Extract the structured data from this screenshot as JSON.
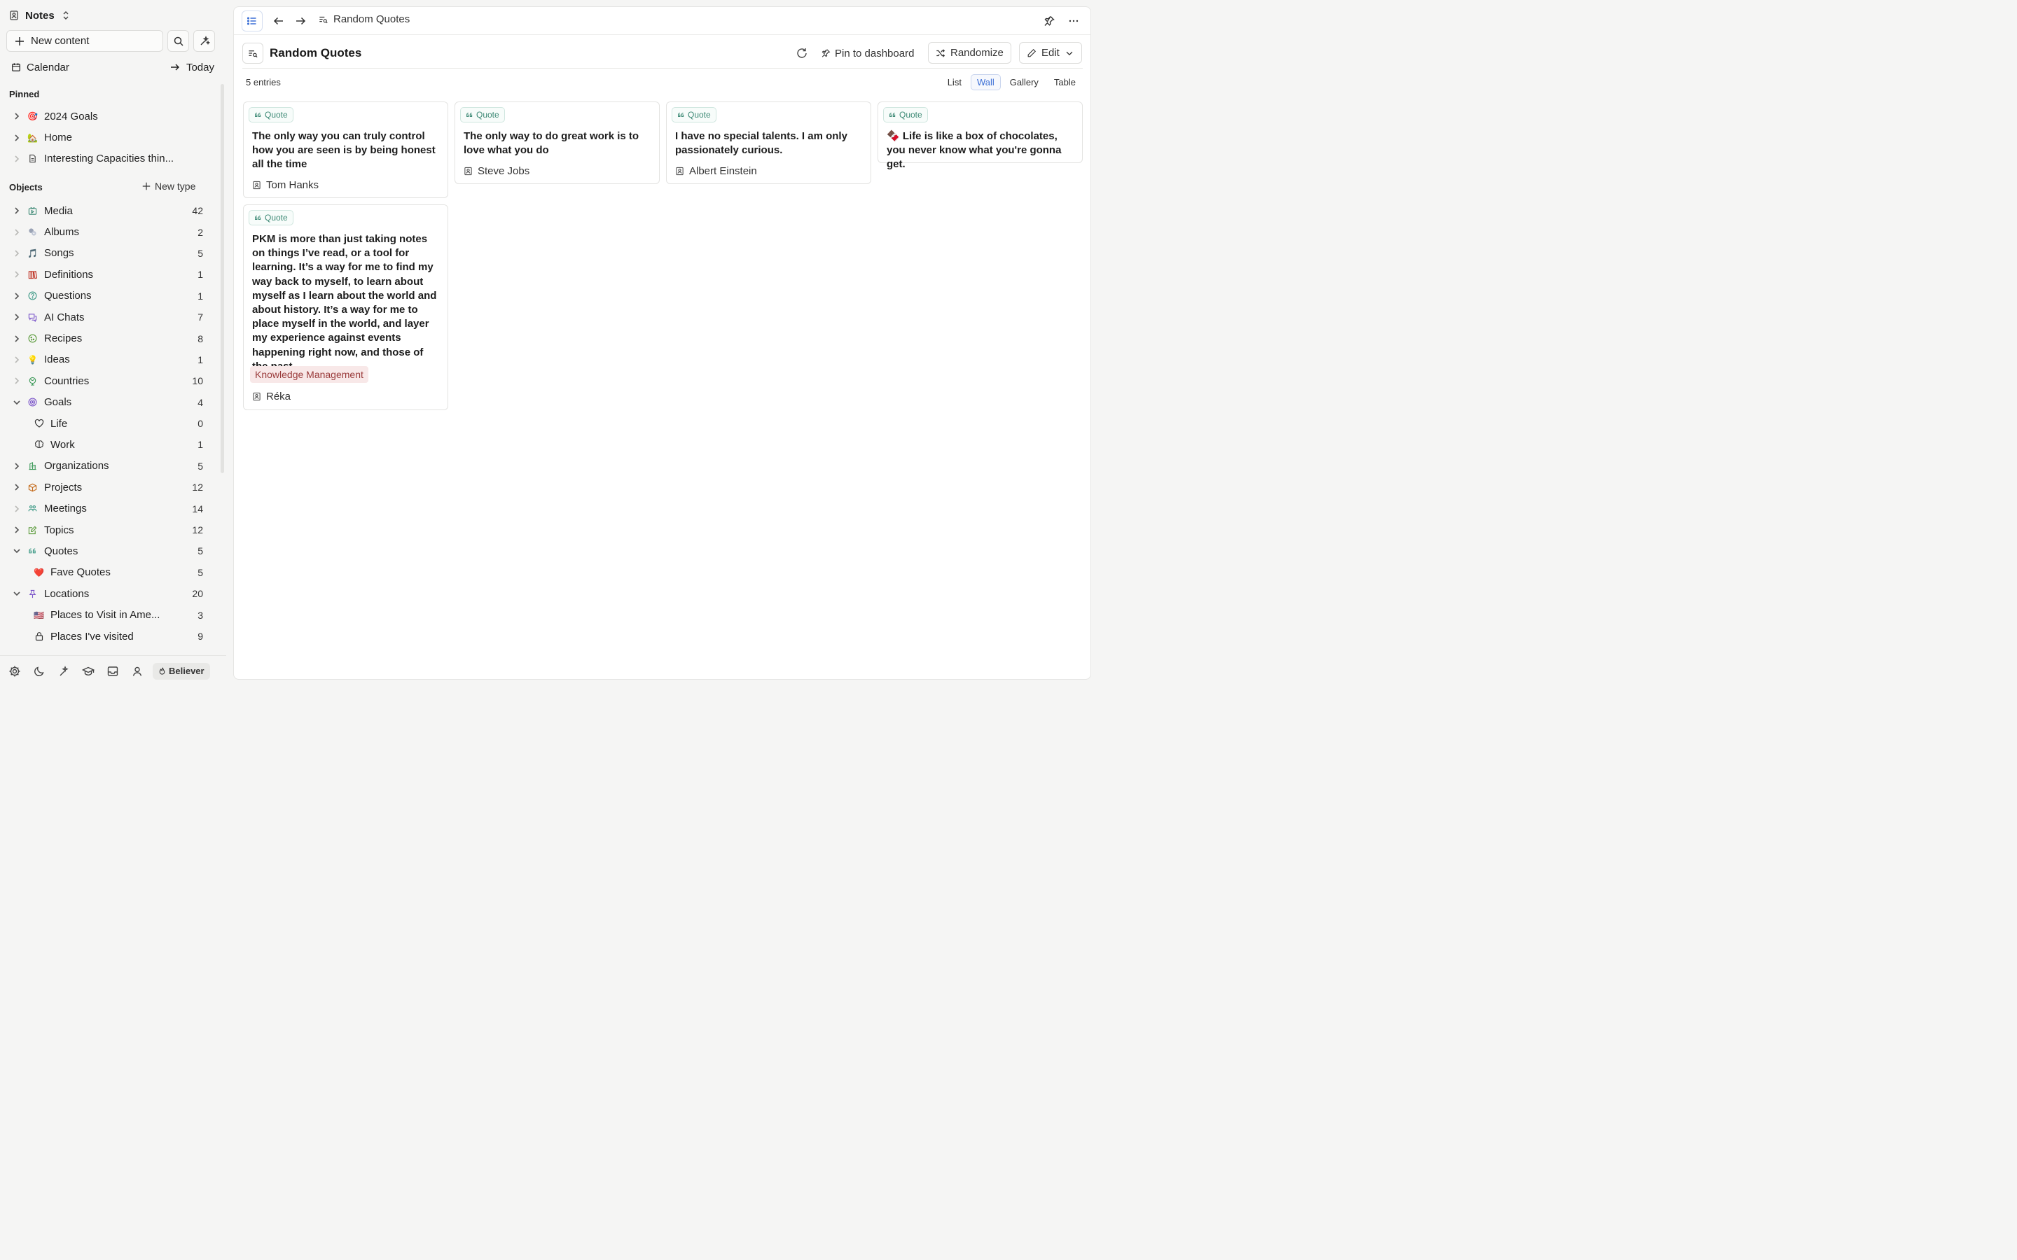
{
  "sidebar": {
    "space_title": "Notes",
    "new_content_label": "New content",
    "calendar_label": "Calendar",
    "today_label": "Today",
    "pinned_header": "Pinned",
    "pinned": [
      {
        "label": "2024 Goals",
        "icon": "🎯"
      },
      {
        "label": "Home",
        "icon": "🏡"
      },
      {
        "label": "Interesting Capacities thin...",
        "icon": "document-icon"
      }
    ],
    "objects_header": "Objects",
    "new_type_label": "New type",
    "objects": [
      {
        "label": "Media",
        "count": "42",
        "icon": "media-icon",
        "color": "#3e8a76"
      },
      {
        "label": "Albums",
        "count": "2",
        "icon": "albums-icon"
      },
      {
        "label": "Songs",
        "count": "5",
        "icon": "🎵"
      },
      {
        "label": "Definitions",
        "count": "1",
        "icon": "books-icon",
        "color": "#c0392b"
      },
      {
        "label": "Questions",
        "count": "1",
        "icon": "question-icon",
        "color": "#3e9a86"
      },
      {
        "label": "AI Chats",
        "count": "7",
        "icon": "chat-icon",
        "color": "#7b55c9"
      },
      {
        "label": "Recipes",
        "count": "8",
        "icon": "cookie-icon",
        "color": "#5a9a3a"
      },
      {
        "label": "Ideas",
        "count": "1",
        "icon": "💡"
      },
      {
        "label": "Countries",
        "count": "10",
        "icon": "globe-icon",
        "color": "#3e9a5a"
      },
      {
        "label": "Goals",
        "count": "4",
        "icon": "target-icon",
        "color": "#7b55c9"
      },
      {
        "label": "Life",
        "count": "0",
        "icon": "heart-icon"
      },
      {
        "label": "Work",
        "count": "1",
        "icon": "brain-icon"
      },
      {
        "label": "Organizations",
        "count": "5",
        "icon": "building-icon",
        "color": "#3e9a5a"
      },
      {
        "label": "Projects",
        "count": "12",
        "icon": "package-icon",
        "color": "#c46a1a"
      },
      {
        "label": "Meetings",
        "count": "14",
        "icon": "people-icon",
        "color": "#3e9a86"
      },
      {
        "label": "Topics",
        "count": "12",
        "icon": "pencil-square-icon",
        "color": "#5a9a3a"
      },
      {
        "label": "Quotes",
        "count": "5",
        "icon": "quote-icon",
        "color": "#3e9a86"
      },
      {
        "label": "Fave Quotes",
        "count": "5",
        "icon": "❤️"
      },
      {
        "label": "Locations",
        "count": "20",
        "icon": "pin-icon",
        "color": "#7b55c9"
      },
      {
        "label": "Places to Visit in Ame...",
        "count": "3",
        "icon": "🇺🇸"
      },
      {
        "label": "Places I've visited",
        "count": "9",
        "icon": "lock-icon"
      }
    ],
    "footer_badge": "Believer"
  },
  "topbar": {
    "breadcrumb_label": "Random Quotes"
  },
  "page": {
    "title": "Random Quotes",
    "pin_label": "Pin to dashboard",
    "randomize_label": "Randomize",
    "edit_label": "Edit",
    "entries_label": "5 entries",
    "views": [
      "List",
      "Wall",
      "Gallery",
      "Table"
    ],
    "active_view": "Wall"
  },
  "cards": [
    {
      "type": "Quote",
      "text": "The only way you can truly control how you are seen is by being honest all the time",
      "author": "Tom Hanks"
    },
    {
      "type": "Quote",
      "text": "The only way to do great work is to love what you do",
      "author": "Steve Jobs"
    },
    {
      "type": "Quote",
      "text": "I have no special talents. I am only passionately curious.",
      "author": "Albert Einstein"
    },
    {
      "type": "Quote",
      "emoji": "🍫",
      "text": "Life is like a box of chocolates, you never know what you're gonna get.",
      "author": ""
    },
    {
      "type": "Quote",
      "text": "PKM is more than just taking notes on things I’ve read, or a tool for learning. It’s a way for me to find my way back to myself, to learn about myself as I learn about the world and about history. It’s a way for me to place myself in the world, and layer my experience against events happening right now, and those of the past",
      "tag": "Knowledge Management",
      "author": "Réka"
    }
  ],
  "colors": {
    "accent": "#3b6fd6",
    "quote_chip": "#3e8a76",
    "tag_bg": "#f8e8e8",
    "tag_text": "#9a3b3b"
  }
}
